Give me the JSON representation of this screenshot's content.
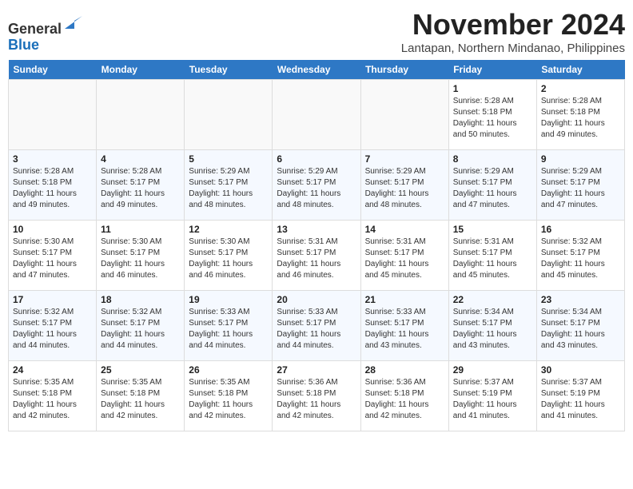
{
  "header": {
    "logo_line1": "General",
    "logo_line2": "Blue",
    "month_year": "November 2024",
    "location": "Lantapan, Northern Mindanao, Philippines"
  },
  "days_of_week": [
    "Sunday",
    "Monday",
    "Tuesday",
    "Wednesday",
    "Thursday",
    "Friday",
    "Saturday"
  ],
  "weeks": [
    [
      {
        "day": "",
        "sunrise": "",
        "sunset": "",
        "daylight": ""
      },
      {
        "day": "",
        "sunrise": "",
        "sunset": "",
        "daylight": ""
      },
      {
        "day": "",
        "sunrise": "",
        "sunset": "",
        "daylight": ""
      },
      {
        "day": "",
        "sunrise": "",
        "sunset": "",
        "daylight": ""
      },
      {
        "day": "",
        "sunrise": "",
        "sunset": "",
        "daylight": ""
      },
      {
        "day": "1",
        "sunrise": "Sunrise: 5:28 AM",
        "sunset": "Sunset: 5:18 PM",
        "daylight": "Daylight: 11 hours and 50 minutes."
      },
      {
        "day": "2",
        "sunrise": "Sunrise: 5:28 AM",
        "sunset": "Sunset: 5:18 PM",
        "daylight": "Daylight: 11 hours and 49 minutes."
      }
    ],
    [
      {
        "day": "3",
        "sunrise": "Sunrise: 5:28 AM",
        "sunset": "Sunset: 5:18 PM",
        "daylight": "Daylight: 11 hours and 49 minutes."
      },
      {
        "day": "4",
        "sunrise": "Sunrise: 5:28 AM",
        "sunset": "Sunset: 5:17 PM",
        "daylight": "Daylight: 11 hours and 49 minutes."
      },
      {
        "day": "5",
        "sunrise": "Sunrise: 5:29 AM",
        "sunset": "Sunset: 5:17 PM",
        "daylight": "Daylight: 11 hours and 48 minutes."
      },
      {
        "day": "6",
        "sunrise": "Sunrise: 5:29 AM",
        "sunset": "Sunset: 5:17 PM",
        "daylight": "Daylight: 11 hours and 48 minutes."
      },
      {
        "day": "7",
        "sunrise": "Sunrise: 5:29 AM",
        "sunset": "Sunset: 5:17 PM",
        "daylight": "Daylight: 11 hours and 48 minutes."
      },
      {
        "day": "8",
        "sunrise": "Sunrise: 5:29 AM",
        "sunset": "Sunset: 5:17 PM",
        "daylight": "Daylight: 11 hours and 47 minutes."
      },
      {
        "day": "9",
        "sunrise": "Sunrise: 5:29 AM",
        "sunset": "Sunset: 5:17 PM",
        "daylight": "Daylight: 11 hours and 47 minutes."
      }
    ],
    [
      {
        "day": "10",
        "sunrise": "Sunrise: 5:30 AM",
        "sunset": "Sunset: 5:17 PM",
        "daylight": "Daylight: 11 hours and 47 minutes."
      },
      {
        "day": "11",
        "sunrise": "Sunrise: 5:30 AM",
        "sunset": "Sunset: 5:17 PM",
        "daylight": "Daylight: 11 hours and 46 minutes."
      },
      {
        "day": "12",
        "sunrise": "Sunrise: 5:30 AM",
        "sunset": "Sunset: 5:17 PM",
        "daylight": "Daylight: 11 hours and 46 minutes."
      },
      {
        "day": "13",
        "sunrise": "Sunrise: 5:31 AM",
        "sunset": "Sunset: 5:17 PM",
        "daylight": "Daylight: 11 hours and 46 minutes."
      },
      {
        "day": "14",
        "sunrise": "Sunrise: 5:31 AM",
        "sunset": "Sunset: 5:17 PM",
        "daylight": "Daylight: 11 hours and 45 minutes."
      },
      {
        "day": "15",
        "sunrise": "Sunrise: 5:31 AM",
        "sunset": "Sunset: 5:17 PM",
        "daylight": "Daylight: 11 hours and 45 minutes."
      },
      {
        "day": "16",
        "sunrise": "Sunrise: 5:32 AM",
        "sunset": "Sunset: 5:17 PM",
        "daylight": "Daylight: 11 hours and 45 minutes."
      }
    ],
    [
      {
        "day": "17",
        "sunrise": "Sunrise: 5:32 AM",
        "sunset": "Sunset: 5:17 PM",
        "daylight": "Daylight: 11 hours and 44 minutes."
      },
      {
        "day": "18",
        "sunrise": "Sunrise: 5:32 AM",
        "sunset": "Sunset: 5:17 PM",
        "daylight": "Daylight: 11 hours and 44 minutes."
      },
      {
        "day": "19",
        "sunrise": "Sunrise: 5:33 AM",
        "sunset": "Sunset: 5:17 PM",
        "daylight": "Daylight: 11 hours and 44 minutes."
      },
      {
        "day": "20",
        "sunrise": "Sunrise: 5:33 AM",
        "sunset": "Sunset: 5:17 PM",
        "daylight": "Daylight: 11 hours and 44 minutes."
      },
      {
        "day": "21",
        "sunrise": "Sunrise: 5:33 AM",
        "sunset": "Sunset: 5:17 PM",
        "daylight": "Daylight: 11 hours and 43 minutes."
      },
      {
        "day": "22",
        "sunrise": "Sunrise: 5:34 AM",
        "sunset": "Sunset: 5:17 PM",
        "daylight": "Daylight: 11 hours and 43 minutes."
      },
      {
        "day": "23",
        "sunrise": "Sunrise: 5:34 AM",
        "sunset": "Sunset: 5:17 PM",
        "daylight": "Daylight: 11 hours and 43 minutes."
      }
    ],
    [
      {
        "day": "24",
        "sunrise": "Sunrise: 5:35 AM",
        "sunset": "Sunset: 5:18 PM",
        "daylight": "Daylight: 11 hours and 42 minutes."
      },
      {
        "day": "25",
        "sunrise": "Sunrise: 5:35 AM",
        "sunset": "Sunset: 5:18 PM",
        "daylight": "Daylight: 11 hours and 42 minutes."
      },
      {
        "day": "26",
        "sunrise": "Sunrise: 5:35 AM",
        "sunset": "Sunset: 5:18 PM",
        "daylight": "Daylight: 11 hours and 42 minutes."
      },
      {
        "day": "27",
        "sunrise": "Sunrise: 5:36 AM",
        "sunset": "Sunset: 5:18 PM",
        "daylight": "Daylight: 11 hours and 42 minutes."
      },
      {
        "day": "28",
        "sunrise": "Sunrise: 5:36 AM",
        "sunset": "Sunset: 5:18 PM",
        "daylight": "Daylight: 11 hours and 42 minutes."
      },
      {
        "day": "29",
        "sunrise": "Sunrise: 5:37 AM",
        "sunset": "Sunset: 5:19 PM",
        "daylight": "Daylight: 11 hours and 41 minutes."
      },
      {
        "day": "30",
        "sunrise": "Sunrise: 5:37 AM",
        "sunset": "Sunset: 5:19 PM",
        "daylight": "Daylight: 11 hours and 41 minutes."
      }
    ]
  ]
}
